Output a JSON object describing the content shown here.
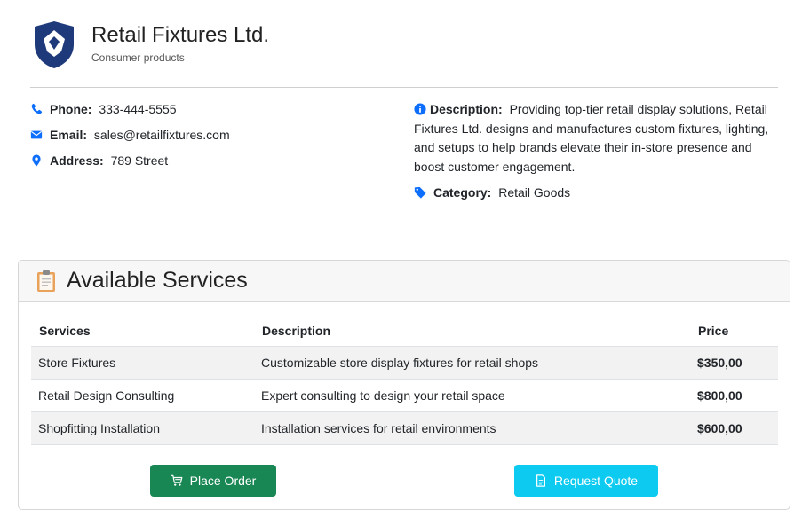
{
  "company": {
    "name": "Retail Fixtures Ltd.",
    "subtitle": "Consumer products",
    "logo_icon": "shield-logo-icon",
    "brand_color": "#1f3a7a"
  },
  "contact": {
    "phone_label": "Phone:",
    "phone": "333-444-5555",
    "email_label": "Email:",
    "email": "sales@retailfixtures.com",
    "address_label": "Address:",
    "address": "789 Street"
  },
  "details": {
    "description_label": "Description:",
    "description": "Providing top-tier retail display solutions, Retail Fixtures Ltd. designs and manufactures custom fixtures, lighting, and setups to help brands elevate their in-store presence and boost customer engagement.",
    "category_label": "Category:",
    "category": "Retail Goods"
  },
  "services": {
    "title": "Available Services",
    "icon": "clipboard-icon",
    "columns": [
      "Services",
      "Description",
      "Price"
    ],
    "rows": [
      {
        "name": "Store Fixtures",
        "description": "Customizable store display fixtures for retail shops",
        "price": "$350,00"
      },
      {
        "name": "Retail Design Consulting",
        "description": "Expert consulting to design your retail space",
        "price": "$800,00"
      },
      {
        "name": "Shopfitting Installation",
        "description": "Installation services for retail environments",
        "price": "$600,00"
      }
    ]
  },
  "actions": {
    "order_label": "Place Order",
    "order_color": "#198754",
    "quote_label": "Request Quote",
    "quote_color": "#0dcaf0"
  },
  "colors": {
    "icon_blue": "#0d6efd"
  }
}
